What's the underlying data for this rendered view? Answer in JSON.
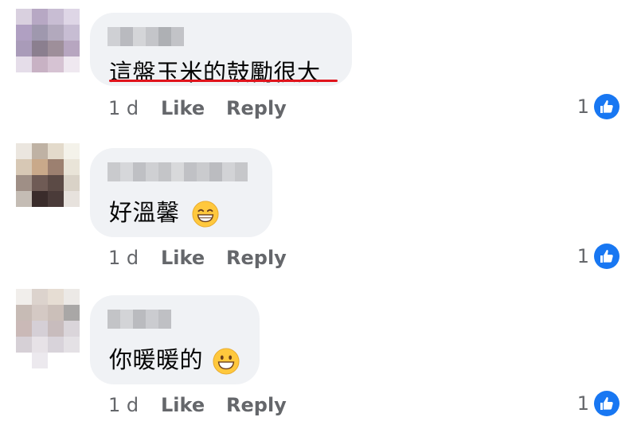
{
  "comments": [
    {
      "text": "這盤玉米的鼓勵很大",
      "time": "1 d",
      "like_label": "Like",
      "reply_label": "Reply",
      "reaction_count": "1",
      "underline_color": "#e0141c"
    },
    {
      "text": "好溫馨",
      "emoji": "grinning-face-smiling-eyes",
      "time": "1 d",
      "like_label": "Like",
      "reply_label": "Reply",
      "reaction_count": "1"
    },
    {
      "text": "你暖暖的",
      "emoji": "grinning-face",
      "time": "1 d",
      "like_label": "Like",
      "reply_label": "Reply",
      "reaction_count": "1"
    }
  ],
  "colors": {
    "bubble": "#f0f2f5",
    "meta_text": "#65676b",
    "like_blue": "#1877f2"
  }
}
